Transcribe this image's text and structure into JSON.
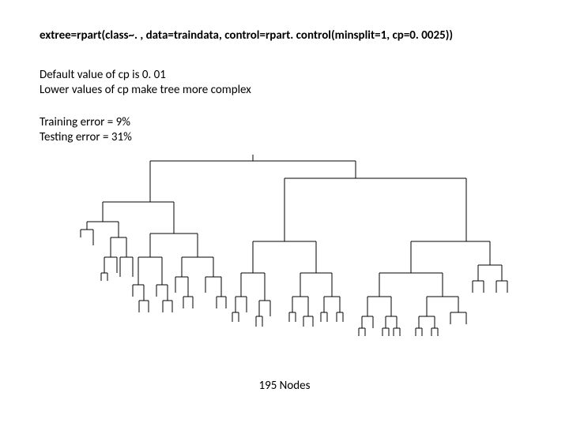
{
  "code": "extree=rpart(class~. , data=traindata, control=rpart. control(minsplit=1, cp=0. 0025))",
  "cp_default": "Default value of cp is 0. 01",
  "cp_lower": "Lower values of cp make tree more complex",
  "train_err": "Training error = 9%",
  "test_err": "Testing error = 31%",
  "nodes": "195 Nodes"
}
